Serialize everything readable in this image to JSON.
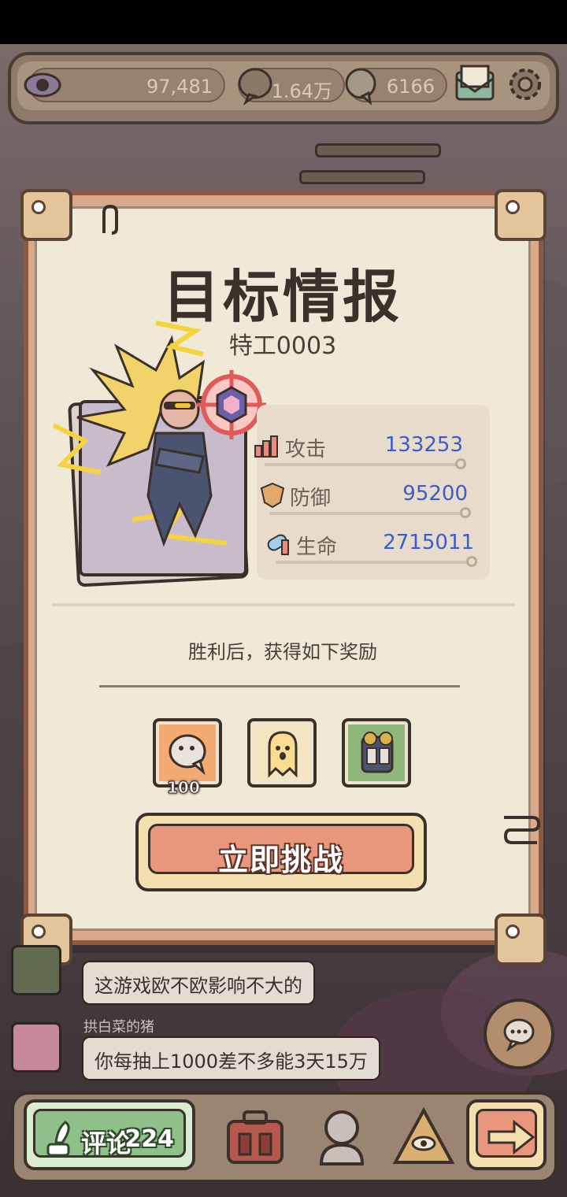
{
  "topbar": {
    "views": "97,481",
    "bubbles": "1.64万",
    "ghosts": "6166",
    "icons": [
      "eye-icon",
      "speech-bubble-icon",
      "ghost-bubble-icon",
      "mail-icon",
      "gear-icon"
    ]
  },
  "panel": {
    "title": "目标情报",
    "subtitle": "特工0003",
    "stats": [
      {
        "label": "攻击",
        "value": "133253",
        "icon": "attack-icon"
      },
      {
        "label": "防御",
        "value": "95200",
        "icon": "defense-icon"
      },
      {
        "label": "生命",
        "value": "2715011",
        "icon": "health-icon"
      }
    ],
    "reward_title": "胜利后，获得如下奖励",
    "rewards": [
      {
        "name": "bubble-currency",
        "count": "100",
        "color": "#f3ab73"
      },
      {
        "name": "ghost-sheet",
        "count": "",
        "color": "#f4e6c2"
      },
      {
        "name": "gear-pack",
        "count": "",
        "color": "#8fb77c"
      }
    ],
    "challenge_label": "立即挑战"
  },
  "chat": {
    "messages": [
      {
        "name": "",
        "text": "这游戏欧不欧影响不大的"
      },
      {
        "name": "拱白菜的猪",
        "text": "你每抽上1000差不多能3天15万"
      }
    ]
  },
  "bottombar": {
    "comment_label": "评论",
    "comment_count": "224",
    "icons": [
      "quill-icon",
      "briefcase-icon",
      "bust-statue-icon",
      "pyramid-eye-icon",
      "arrow-right-icon"
    ]
  },
  "colors": {
    "accent_blue": "#3f5bc9",
    "challenge_orange": "#e8977d",
    "comment_green": "#8fc08a"
  }
}
